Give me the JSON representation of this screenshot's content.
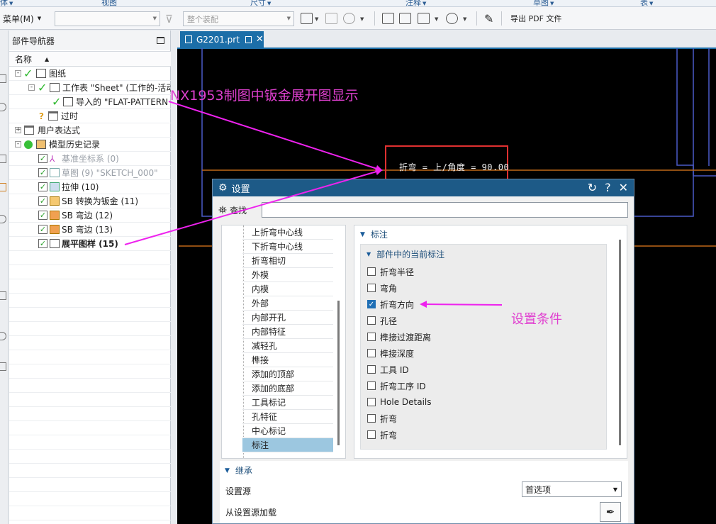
{
  "ribbon_labels": [
    "体",
    "视图",
    "尺寸",
    "注释",
    "草图",
    "表"
  ],
  "toolbar": {
    "menu_label": "菜单(M)",
    "filter_combo_value": "",
    "assembly_combo_value": "整个装配",
    "export_pdf_label": "导出 PDF 文件"
  },
  "navigator": {
    "title": "部件导航器",
    "column_name": "名称",
    "nodes": [
      {
        "label": "图纸"
      },
      {
        "label": "工作表 \"Sheet\" (工作的-活动"
      },
      {
        "label": "导入的 \"FLAT-PATTERN"
      },
      {
        "label": "过时"
      },
      {
        "label": "用户表达式"
      },
      {
        "label": "模型历史记录"
      },
      {
        "label": "基准坐标系 (0)"
      },
      {
        "label": "草图 (9) \"SKETCH_000\""
      },
      {
        "label": "拉伸 (10)"
      },
      {
        "label": "SB 转换为钣金 (11)"
      },
      {
        "label": "SB 弯边 (12)"
      },
      {
        "label": "SB 弯边 (13)"
      },
      {
        "label": "展平图样 (15)"
      }
    ]
  },
  "graphics": {
    "tab_label": "G2201.prt",
    "drawing_title": "NX1953制图中钣金展开图显示",
    "bend_note": "折弯 = 上/角度 = 90.00"
  },
  "dialog": {
    "title": "设置",
    "find_label": "查找",
    "find_value": "",
    "categories": [
      "上折弯中心线",
      "下折弯中心线",
      "折弯相切",
      "外模",
      "内模",
      "外部",
      "内部开孔",
      "内部特征",
      "减轻孔",
      "榫接",
      "添加的顶部",
      "添加的底部",
      "工具标记",
      "孔特征",
      "中心标记",
      "标注"
    ],
    "selected_category": "标注",
    "section_title": "标注",
    "subgroup_title": "部件中的当前标注",
    "options": [
      {
        "label": "折弯半径",
        "checked": false
      },
      {
        "label": "弯角",
        "checked": false
      },
      {
        "label": "折弯方向",
        "checked": true
      },
      {
        "label": "孔径",
        "checked": false
      },
      {
        "label": "榫接过渡距离",
        "checked": false
      },
      {
        "label": "榫接深度",
        "checked": false
      },
      {
        "label": "工具 ID",
        "checked": false
      },
      {
        "label": "折弯工序 ID",
        "checked": false
      },
      {
        "label": "Hole Details",
        "checked": false
      },
      {
        "label": "折弯",
        "checked": false
      },
      {
        "label": "折弯",
        "checked": false
      }
    ],
    "inherit_title": "继承",
    "settings_source_label": "设置源",
    "settings_source_value": "首选项",
    "load_from_source_label": "从设置源加载"
  },
  "annotation": "设置条件",
  "colors": {
    "accent_blue": "#1d5a87",
    "tab_blue": "#1c6ea8",
    "annotation_magenta": "#e040d0",
    "highlight_red": "#e03030",
    "selected_row": "#9cc7e0"
  }
}
